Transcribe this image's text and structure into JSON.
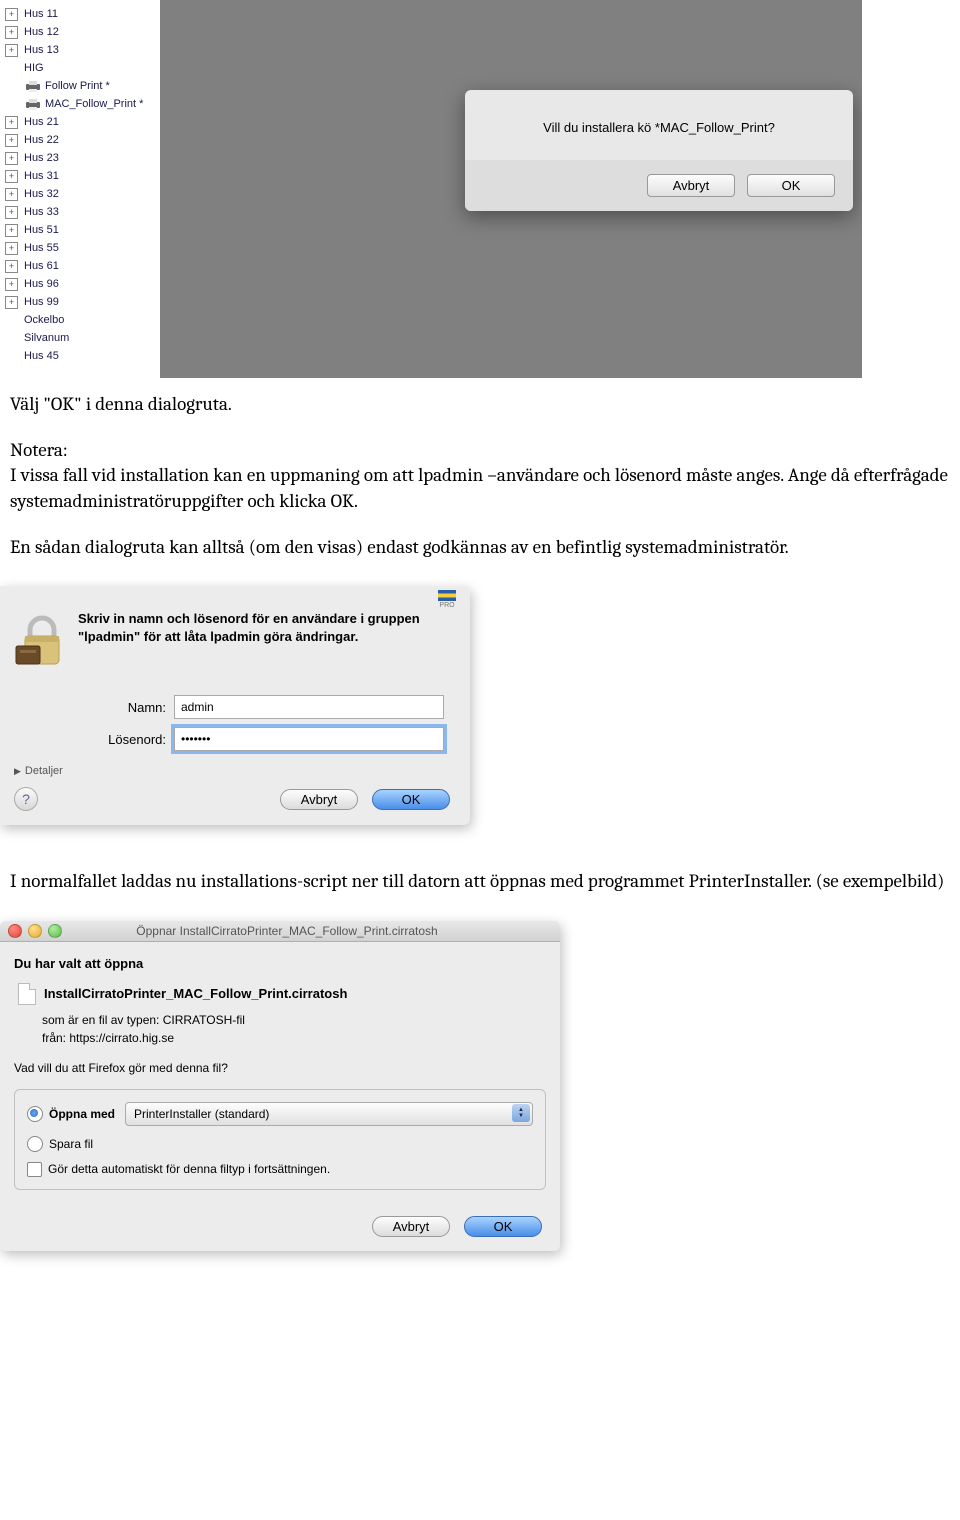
{
  "tree": {
    "items": [
      {
        "label": "Hus 11",
        "type": "folder"
      },
      {
        "label": "Hus 12",
        "type": "folder"
      },
      {
        "label": "Hus 13",
        "type": "folder"
      },
      {
        "label": "HIG",
        "type": "child"
      },
      {
        "label": "Follow Print *",
        "type": "printer"
      },
      {
        "label": "MAC_Follow_Print *",
        "type": "printer"
      },
      {
        "label": "Hus 21",
        "type": "folder"
      },
      {
        "label": "Hus 22",
        "type": "folder"
      },
      {
        "label": "Hus 23",
        "type": "folder"
      },
      {
        "label": "Hus 31",
        "type": "folder"
      },
      {
        "label": "Hus 32",
        "type": "folder"
      },
      {
        "label": "Hus 33",
        "type": "folder"
      },
      {
        "label": "Hus 51",
        "type": "folder"
      },
      {
        "label": "Hus 55",
        "type": "folder"
      },
      {
        "label": "Hus 61",
        "type": "folder"
      },
      {
        "label": "Hus 96",
        "type": "folder"
      },
      {
        "label": "Hus 99",
        "type": "folder"
      },
      {
        "label": "Ockelbo",
        "type": "leaf"
      },
      {
        "label": "Silvanum",
        "type": "leaf"
      },
      {
        "label": "Hus 45",
        "type": "leaf"
      }
    ]
  },
  "confirm": {
    "message": "Vill du installera kö   *MAC_Follow_Print?",
    "cancel": "Avbryt",
    "ok": "OK"
  },
  "text": {
    "p1": "Välj \"OK\"  i denna dialogruta.",
    "p2a": "Notera:",
    "p2b": "I vissa fall vid installation kan en uppmaning om att lpadmin –användare och lösenord måste anges.  Ange då efterfrågade systemadministratöruppgifter och klicka OK.",
    "p3": "En sådan dialogruta kan alltså (om den visas) endast godkännas av en befintlig systemadministratör.",
    "p4": "I normalfallet laddas nu installations-script ner till datorn att öppnas med programmet PrinterInstaller. (se exempelbild)"
  },
  "auth": {
    "pro": "PRO",
    "prompt": "Skriv in namn och lösenord för en användare i gruppen \"lpadmin\" för att låta lpadmin göra ändringar.",
    "name_label": "Namn:",
    "name_value": "admin",
    "pwd_label": "Lösenord:",
    "pwd_value": "•••••••",
    "details": "Detaljer",
    "cancel": "Avbryt",
    "ok": "OK"
  },
  "download": {
    "title": "Öppnar InstallCirratoPrinter_MAC_Follow_Print.cirratosh",
    "heading": "Du har valt att öppna",
    "filename": "InstallCirratoPrinter_MAC_Follow_Print.cirratosh",
    "type_line": "som är en fil av typen: CIRRATOSH-fil",
    "from_line": "från: https://cirrato.hig.se",
    "question": "Vad vill du att Firefox gör med denna fil?",
    "open_with": "Öppna med",
    "app": "PrinterInstaller (standard)",
    "save_file": "Spara fil",
    "auto": "Gör detta automatiskt för denna filtyp i fortsättningen.",
    "cancel": "Avbryt",
    "ok": "OK"
  }
}
